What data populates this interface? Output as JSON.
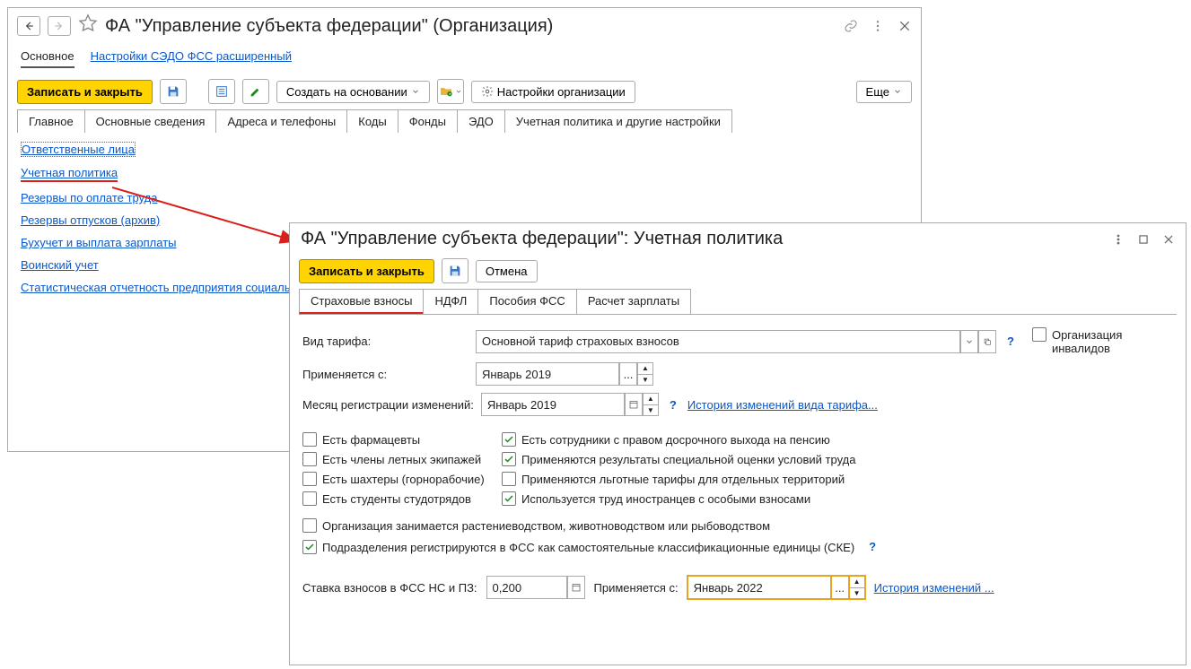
{
  "back": {
    "title": "ФА \"Управление субъекта федерации\" (Организация)",
    "nav": {
      "main": "Основное",
      "sedo": "Настройки СЭДО ФСС расширенный"
    },
    "toolbar": {
      "save_close": "Записать и закрыть",
      "create_based": "Создать на основании",
      "org_settings": "Настройки организации",
      "more": "Еще"
    },
    "tabs": {
      "t1": "Главное",
      "t2": "Основные сведения",
      "t3": "Адреса и телефоны",
      "t4": "Коды",
      "t5": "Фонды",
      "t6": "ЭДО",
      "t7": "Учетная политика и другие настройки"
    },
    "links": {
      "l1": "Ответственные лица",
      "l2": "Учетная политика",
      "l3": "Резервы по оплате труда",
      "l4": "Резервы отпусков (архив)",
      "l5": "Бухучет и выплата зарплаты",
      "l6": "Воинский учет",
      "l7": "Статистическая отчетность предприятия социальн"
    }
  },
  "front": {
    "title": "ФА \"Управление субъекта федерации\": Учетная политика",
    "toolbar": {
      "save_close": "Записать и закрыть",
      "cancel": "Отмена"
    },
    "tabs": {
      "t1": "Страховые взносы",
      "t2": "НДФЛ",
      "t3": "Пособия ФСС",
      "t4": "Расчет зарплаты"
    },
    "fields": {
      "tariff_label": "Вид тарифа:",
      "tariff_value": "Основной тариф страховых взносов",
      "applies_label": "Применяется с:",
      "applies_value": "Январь 2019",
      "reg_month_label": "Месяц регистрации изменений:",
      "reg_month_value": "Январь 2019",
      "history_link": "История изменений вида тарифа...",
      "q": "?",
      "dots": "...",
      "org_invalid": "Организация инвалидов"
    },
    "checks": {
      "pharma": "Есть фармацевты",
      "flight": "Есть члены летных экипажей",
      "miners": "Есть шахтеры (горнорабочие)",
      "students": "Есть студенты студотрядов",
      "pension": "Есть сотрудники с правом досрочного выхода на пенсию",
      "sout": "Применяются результаты специальной оценки условий труда",
      "territory": "Применяются льготные тарифы для отдельных территорий",
      "foreign": "Используется труд иностранцев с особыми взносами",
      "agriculture": "Организация занимается растениеводством, животноводством или рыбоводством",
      "ske": "Подразделения регистрируются в ФСС как самостоятельные классификационные единицы (СКЕ)"
    },
    "rate": {
      "label": "Ставка взносов в ФСС НС и ПЗ:",
      "value": "0,200",
      "applies_label": "Применяется с:",
      "applies_value": "Январь 2022",
      "history": "История изменений ..."
    }
  }
}
